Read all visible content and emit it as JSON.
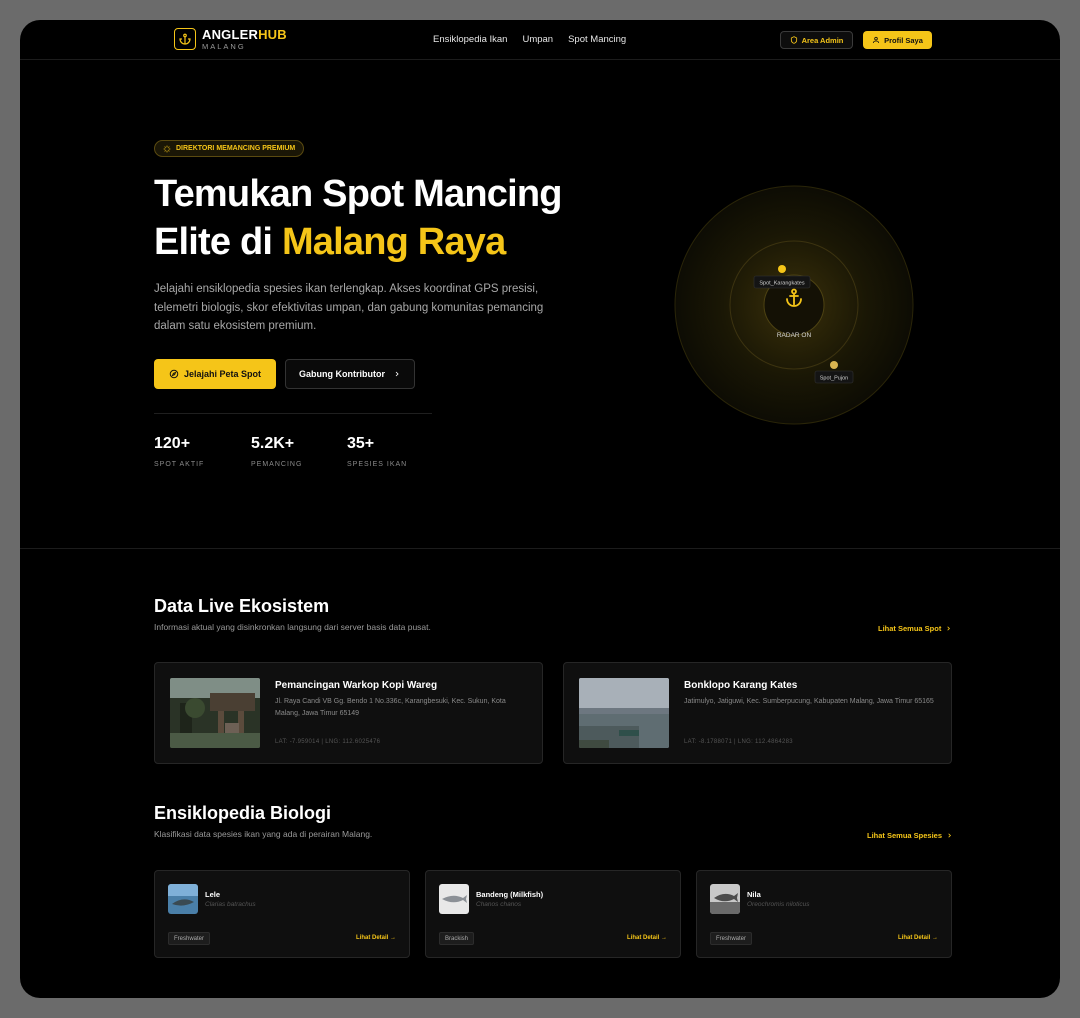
{
  "nav": {
    "logo_main": "ANGLER",
    "logo_accent": "HUB",
    "logo_sub": "MALANG",
    "links": [
      "Ensiklopedia Ikan",
      "Umpan",
      "Spot Mancing"
    ],
    "admin_label": "Area Admin",
    "profile_label": "Profil Saya"
  },
  "hero": {
    "badge": "DIREKTORI MEMANCING PREMIUM",
    "title_line1": "Temukan Spot Mancing",
    "title_line2_plain": "Elite di ",
    "title_line2_accent": "Malang Raya",
    "description": "Jelajahi ensiklopedia spesies ikan terlengkap. Akses koordinat GPS presisi, telemetri biologis, skor efektivitas umpan, dan gabung komunitas pemancing dalam satu ekosistem premium.",
    "primary_button": "Jelajahi Peta Spot",
    "secondary_button": "Gabung Kontributor",
    "stats": [
      {
        "value": "120+",
        "label": "SPOT AKTIF"
      },
      {
        "value": "5.2K+",
        "label": "PEMANCING"
      },
      {
        "value": "35+",
        "label": "SPESIES IKAN"
      }
    ]
  },
  "radar": {
    "center_label": "RADAR ON",
    "points": [
      "Spot_Karangkates",
      "Spot_Pujon"
    ]
  },
  "live": {
    "title": "Data Live Ekosistem",
    "subtitle": "Informasi aktual yang disinkronkan langsung dari server basis data pusat.",
    "link": "Lihat Semua Spot",
    "spots": [
      {
        "name": "Pemancingan Warkop Kopi Wareg",
        "address": "Jl. Raya Candi VB Gg. Bendo 1 No.336c, Karangbesuki, Kec. Sukun, Kota Malang, Jawa Timur 65149",
        "coords": "LAT: -7.959014 | LNG: 112.6025476"
      },
      {
        "name": "Bonklopo Karang Kates",
        "address": "Jatimulyo, Jatiguwi, Kec. Sumberpucung, Kabupaten Malang, Jawa Timur 65165",
        "coords": "LAT: -8.1788071 | LNG: 112.4864283"
      }
    ]
  },
  "encyclopedia": {
    "title": "Ensiklopedia Biologi",
    "subtitle": "Klasifikasi data spesies ikan yang ada di perairan Malang.",
    "link": "Lihat Semua Spesies",
    "fish": [
      {
        "name": "Lele",
        "scientific": "Clarias batrachus",
        "tag": "Freshwater",
        "link": "Lihat Detail →"
      },
      {
        "name": "Bandeng (Milkfish)",
        "scientific": "Chanos chanos",
        "tag": "Brackish",
        "link": "Lihat Detail →"
      },
      {
        "name": "Nila",
        "scientific": "Oreochromis niloticus",
        "tag": "Freshwater",
        "link": "Lihat Detail →"
      }
    ]
  },
  "colors": {
    "accent": "#f5c518",
    "background": "#000000",
    "card": "#0f0f0f"
  }
}
